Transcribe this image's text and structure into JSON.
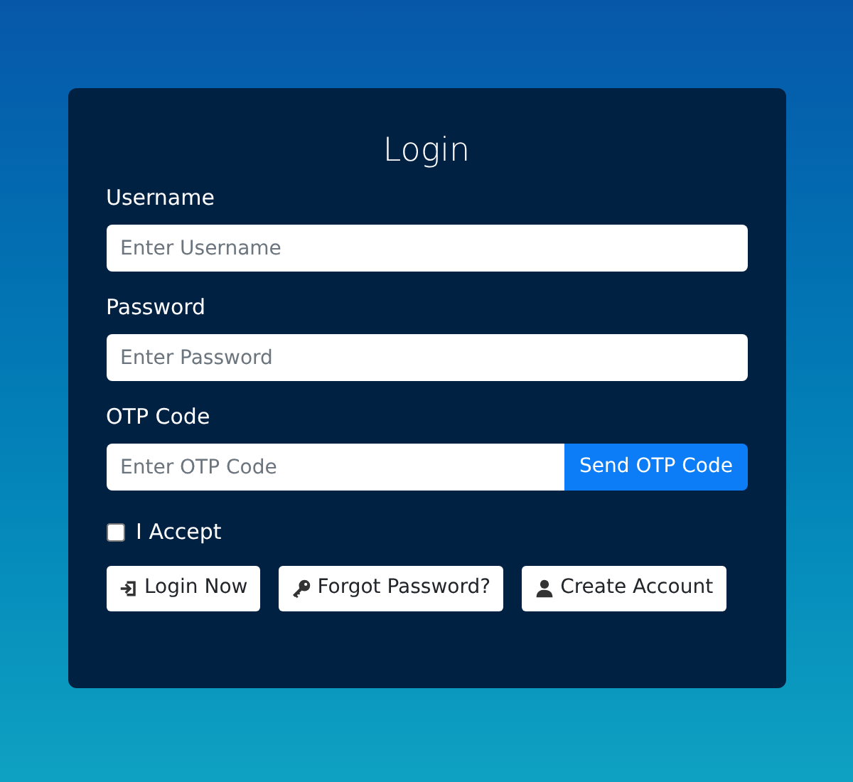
{
  "title": "Login",
  "fields": [
    {
      "label": "Username",
      "placeholder": "Enter Username"
    },
    {
      "label": "Password",
      "placeholder": "Enter Password"
    },
    {
      "label": "OTP Code",
      "placeholder": "Enter OTP Code",
      "button": "Send OTP Code"
    }
  ],
  "accept": {
    "label": "I Accept",
    "checked": false
  },
  "buttons": [
    {
      "kind": "login",
      "label": "Login Now"
    },
    {
      "kind": "key",
      "label": "Forgot Password?"
    },
    {
      "kind": "user",
      "label": "Create Account"
    }
  ]
}
